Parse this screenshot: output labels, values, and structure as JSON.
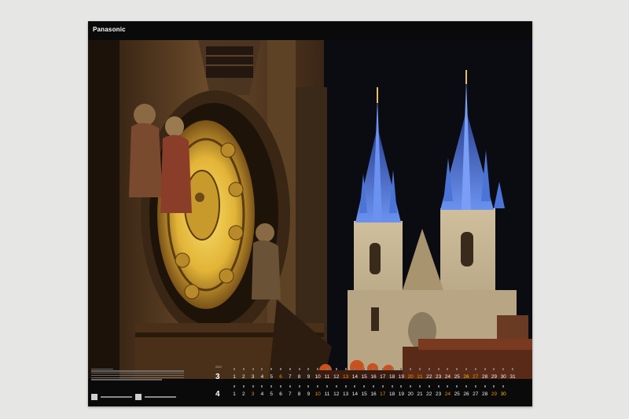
{
  "brand": "Panasonic",
  "colors": {
    "background": "#e6e6e4",
    "calendar_black": "#0a0a0a",
    "sky": "#0b0b12",
    "clock_gold": "#e2b437",
    "spire_blue": "#4a74d6",
    "church_stone": "#d8c8a6",
    "roof_orange": "#c8521f",
    "holiday_yellow": "#f0c400",
    "holiday_orange": "#f08f00"
  },
  "calendar": {
    "months": [
      {
        "number": "3",
        "year": "2022",
        "days": [
          "1",
          "2",
          "3",
          "4",
          "5",
          "6",
          "7",
          "8",
          "9",
          "10",
          "11",
          "12",
          "13",
          "14",
          "15",
          "16",
          "17",
          "18",
          "19",
          "20",
          "21",
          "22",
          "23",
          "24",
          "25",
          "26",
          "27",
          "28",
          "29",
          "30",
          "31"
        ],
        "highlighted": {
          "13": "sun",
          "20": "sun",
          "21": "sun",
          "27": "sun",
          "26": "sat",
          "6": "sun"
        }
      },
      {
        "number": "4",
        "year": "",
        "days": [
          "1",
          "2",
          "3",
          "4",
          "5",
          "6",
          "7",
          "8",
          "9",
          "10",
          "11",
          "12",
          "13",
          "14",
          "15",
          "16",
          "17",
          "18",
          "19",
          "20",
          "21",
          "22",
          "23",
          "24",
          "25",
          "26",
          "27",
          "28",
          "29",
          "30"
        ],
        "highlighted": {
          "3": "sun",
          "10": "sun",
          "17": "sun",
          "24": "sun",
          "29": "sun",
          "30": "sat"
        }
      }
    ]
  }
}
